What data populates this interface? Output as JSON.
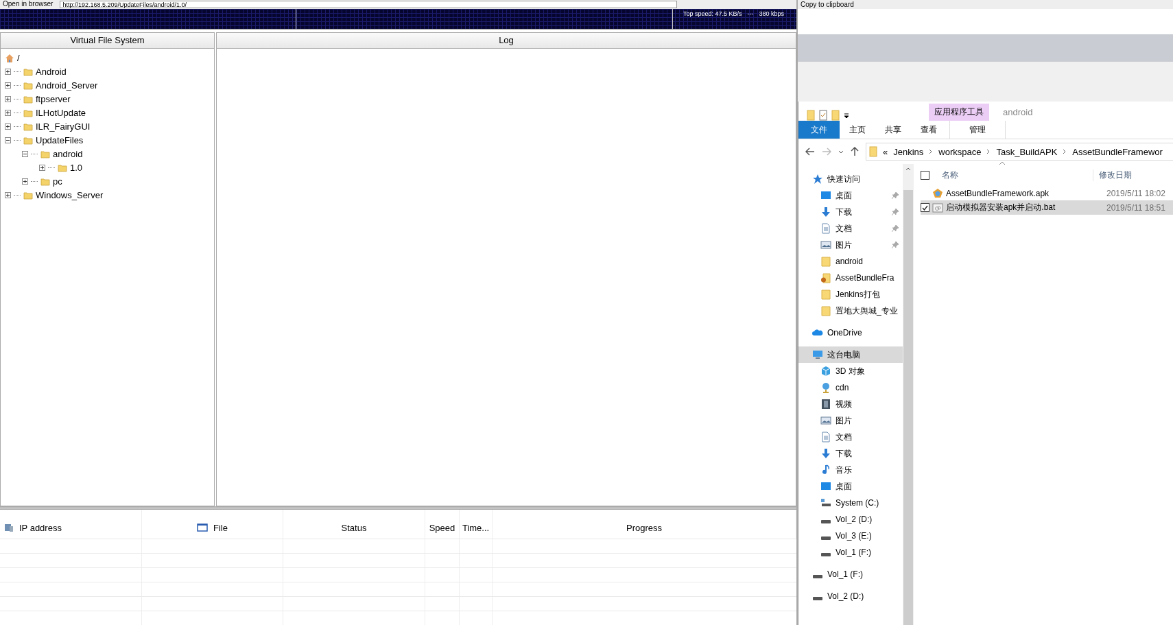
{
  "top_bar": {
    "open_button": "Open in browser",
    "url": "http://192.168.5.209/UpdateFiles/android/1.0/",
    "copy_button": "Copy to clipboard"
  },
  "speed_graph": {
    "top_speed": "Top speed: 47.5 KB/s",
    "separator": "---",
    "rate": "380 kbps"
  },
  "vfs": {
    "title": "Virtual File System",
    "root": "/",
    "tree": [
      {
        "label": "Android",
        "expanded": false
      },
      {
        "label": "Android_Server",
        "expanded": false
      },
      {
        "label": "ftpserver",
        "expanded": false
      },
      {
        "label": "ILHotUpdate",
        "expanded": false
      },
      {
        "label": "ILR_FairyGUI",
        "expanded": false
      },
      {
        "label": "UpdateFiles",
        "expanded": true,
        "children": [
          {
            "label": "android",
            "expanded": true,
            "children": [
              {
                "label": "1.0",
                "expanded": false
              }
            ]
          },
          {
            "label": "pc",
            "expanded": false
          }
        ]
      },
      {
        "label": "Windows_Server",
        "expanded": false
      }
    ]
  },
  "log": {
    "title": "Log"
  },
  "transfers": {
    "columns": [
      {
        "label": "IP address",
        "kind": "ip"
      },
      {
        "label": "File",
        "kind": "file"
      },
      {
        "label": "Status",
        "kind": "text"
      },
      {
        "label": "Speed",
        "kind": "text"
      },
      {
        "label": "Time...",
        "kind": "text"
      },
      {
        "label": "Progress",
        "kind": "text"
      }
    ]
  },
  "explorer": {
    "context_group": "应用程序工具",
    "window_title": "android",
    "ribbon_tabs": [
      {
        "label": "文件",
        "kind": "file"
      },
      {
        "label": "主页",
        "kind": "plain"
      },
      {
        "label": "共享",
        "kind": "plain"
      },
      {
        "label": "查看",
        "kind": "plain"
      },
      {
        "label": "管理",
        "kind": "context"
      }
    ],
    "address": {
      "overflow": "«",
      "crumbs": [
        "Jenkins",
        "workspace",
        "Task_BuildAPK",
        "AssetBundleFramewor"
      ]
    },
    "nav": [
      {
        "label": "快速访问",
        "kind": "star",
        "selected": false,
        "children": [
          {
            "label": "桌面",
            "kind": "desktop",
            "pinned": true,
            "selected": false
          },
          {
            "label": "下载",
            "kind": "download",
            "pinned": true,
            "selected": false
          },
          {
            "label": "文档",
            "kind": "document",
            "pinned": true,
            "selected": false
          },
          {
            "label": "图片",
            "kind": "picture",
            "pinned": true,
            "selected": false
          },
          {
            "label": "android",
            "kind": "folder",
            "pinned": false,
            "selected": false
          },
          {
            "label": "AssetBundleFra",
            "kind": "folder-alert",
            "pinned": false,
            "selected": false
          },
          {
            "label": "Jenkins打包",
            "kind": "folder",
            "pinned": false,
            "selected": false
          },
          {
            "label": "置地大舆城_专业",
            "kind": "folder",
            "pinned": false,
            "selected": false
          }
        ]
      },
      {
        "label": "OneDrive",
        "kind": "cloud",
        "selected": false
      },
      {
        "label": "这台电脑",
        "kind": "computer",
        "selected": true,
        "children": [
          {
            "label": "3D 对象",
            "kind": "cube",
            "selected": false
          },
          {
            "label": "cdn",
            "kind": "network",
            "selected": false
          },
          {
            "label": "视频",
            "kind": "video",
            "selected": false
          },
          {
            "label": "图片",
            "kind": "picture",
            "selected": false
          },
          {
            "label": "文档",
            "kind": "document",
            "selected": false
          },
          {
            "label": "下载",
            "kind": "download",
            "selected": false
          },
          {
            "label": "音乐",
            "kind": "music",
            "selected": false
          },
          {
            "label": "桌面",
            "kind": "desktop",
            "selected": false
          },
          {
            "label": "System (C:)",
            "kind": "system-drive",
            "selected": false
          },
          {
            "label": "Vol_2 (D:)",
            "kind": "drive",
            "selected": false
          },
          {
            "label": "Vol_3 (E:)",
            "kind": "drive",
            "selected": false
          },
          {
            "label": "Vol_1 (F:)",
            "kind": "drive",
            "selected": false
          }
        ]
      },
      {
        "label": "Vol_1 (F:)",
        "kind": "drive",
        "selected": false
      },
      {
        "label": "Vol_2 (D:)",
        "kind": "drive",
        "selected": false
      }
    ],
    "columns": {
      "all_checked": false,
      "name": "名称",
      "date": "修改日期"
    },
    "files": [
      {
        "name": "AssetBundleFramework.apk",
        "date": "2019/5/11 18:02",
        "kind": "apk",
        "selected": false,
        "checked": false
      },
      {
        "name": "启动模拟器安装apk并启动.bat",
        "date": "2019/5/11 18:51",
        "kind": "bat",
        "selected": true,
        "checked": true
      }
    ]
  }
}
